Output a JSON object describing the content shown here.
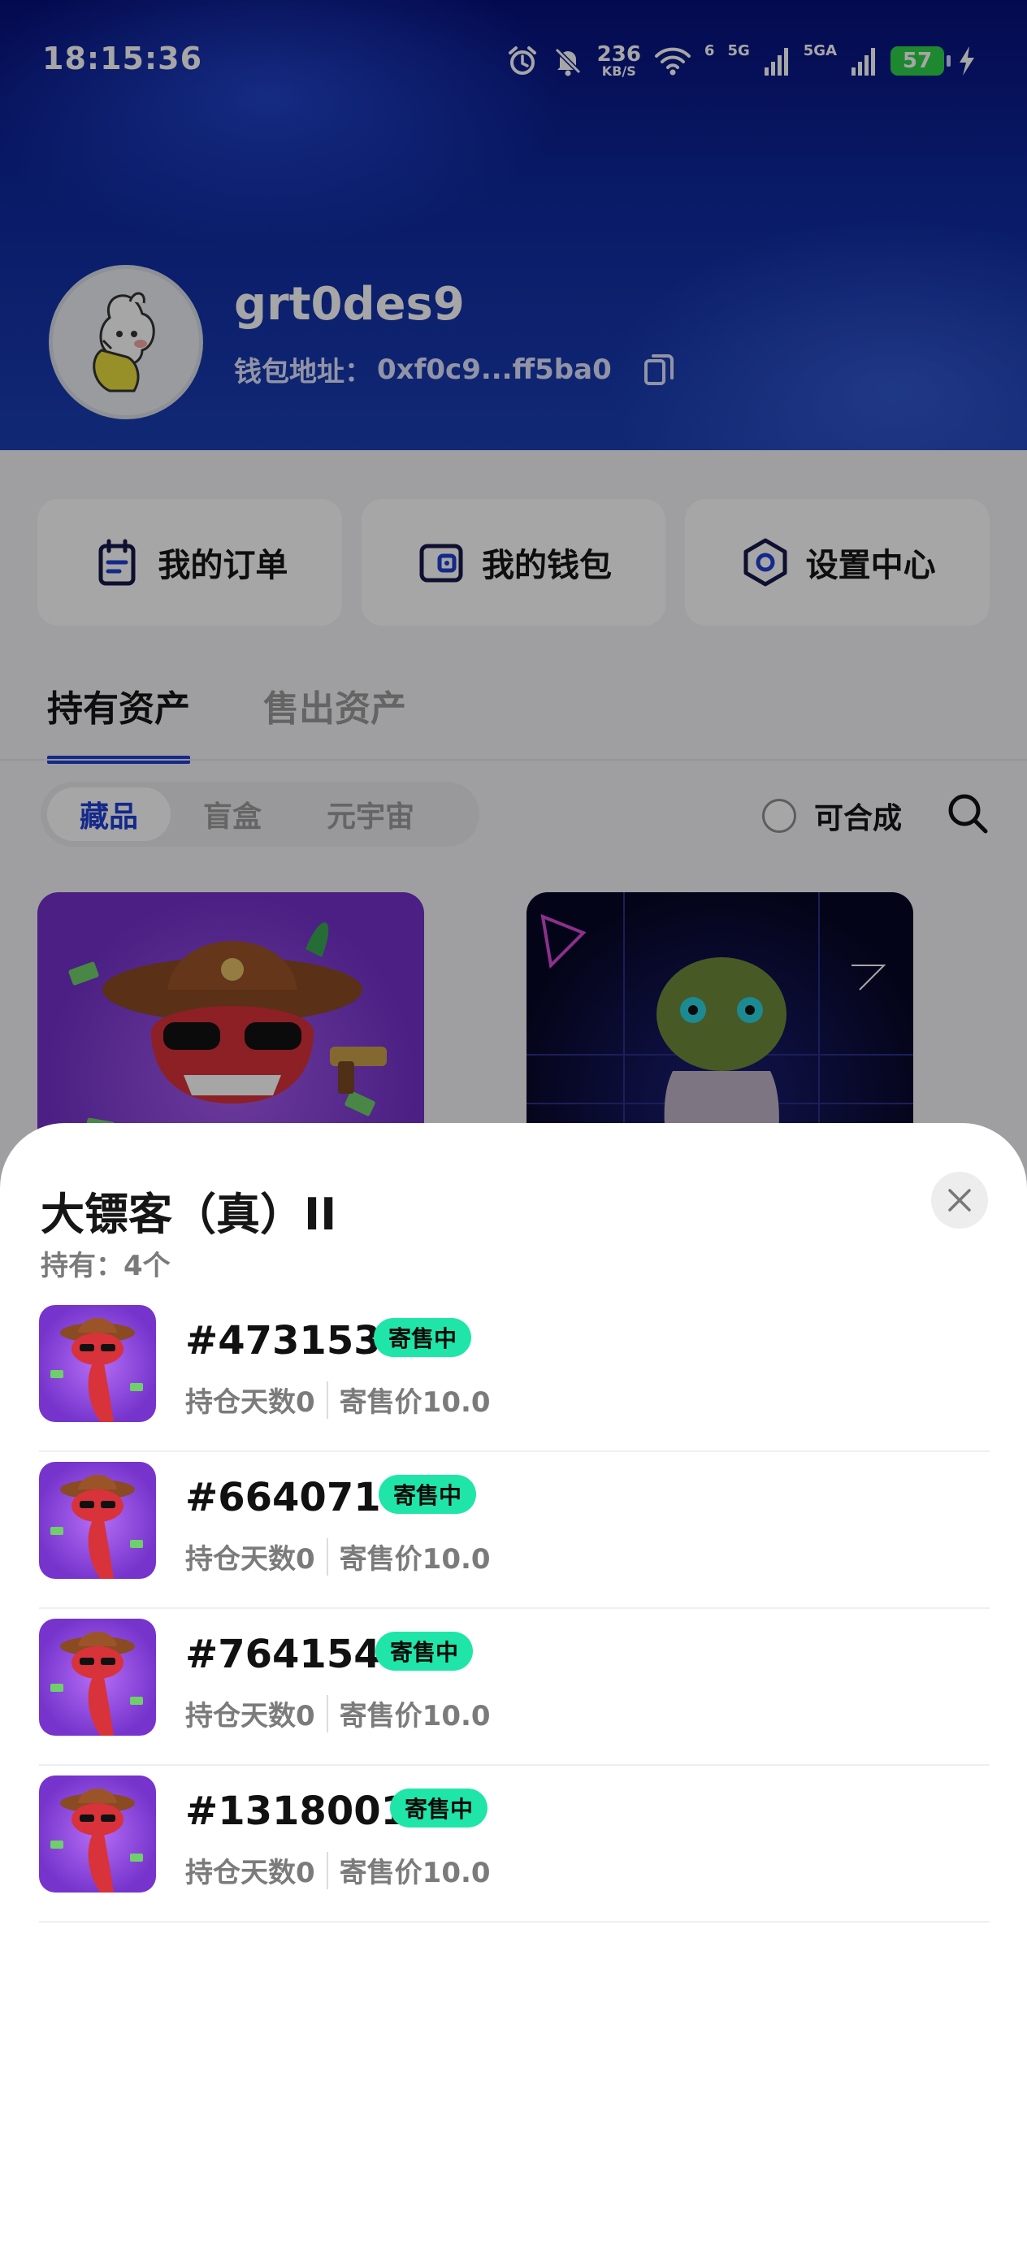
{
  "status_bar": {
    "time": "18:15:36",
    "net_speed": "236",
    "net_speed_unit": "KB/S",
    "wifi_label": "6",
    "sim1_label": "5G",
    "sim2_label": "5GA",
    "battery": "57",
    "icons": [
      "alarm-icon",
      "mute-bell-icon",
      "wifi-icon",
      "signal-icon",
      "charging-icon"
    ]
  },
  "profile": {
    "username": "grt0des9",
    "wallet_label": "钱包地址：",
    "wallet_address": "0xf0c9...ff5ba0"
  },
  "actions": [
    {
      "label": "我的订单",
      "icon": "orders-icon"
    },
    {
      "label": "我的钱包",
      "icon": "wallet-icon"
    },
    {
      "label": "设置中心",
      "icon": "settings-icon"
    }
  ],
  "tabs": {
    "main": [
      "持有资产",
      "售出资产"
    ],
    "sub": [
      "藏品",
      "盲盒",
      "元宇宙"
    ],
    "mergeable_label": "可合成"
  },
  "sheet": {
    "title": "大镖客（真）II",
    "hold": "持有：4个",
    "items": [
      {
        "serial": "#473153",
        "badge": "寄售中",
        "days": "持仓天数0",
        "price": "寄售价10.0"
      },
      {
        "serial": "#664071",
        "badge": "寄售中",
        "days": "持仓天数0",
        "price": "寄售价10.0"
      },
      {
        "serial": "#764154",
        "badge": "寄售中",
        "days": "持仓天数0",
        "price": "寄售价10.0"
      },
      {
        "serial": "#1318001",
        "badge": "寄售中",
        "days": "持仓天数0",
        "price": "寄售价10.0"
      }
    ]
  },
  "colors": {
    "accent": "#1f3fd4",
    "badge": "#1fe6a8",
    "battery": "#2fd24a"
  }
}
